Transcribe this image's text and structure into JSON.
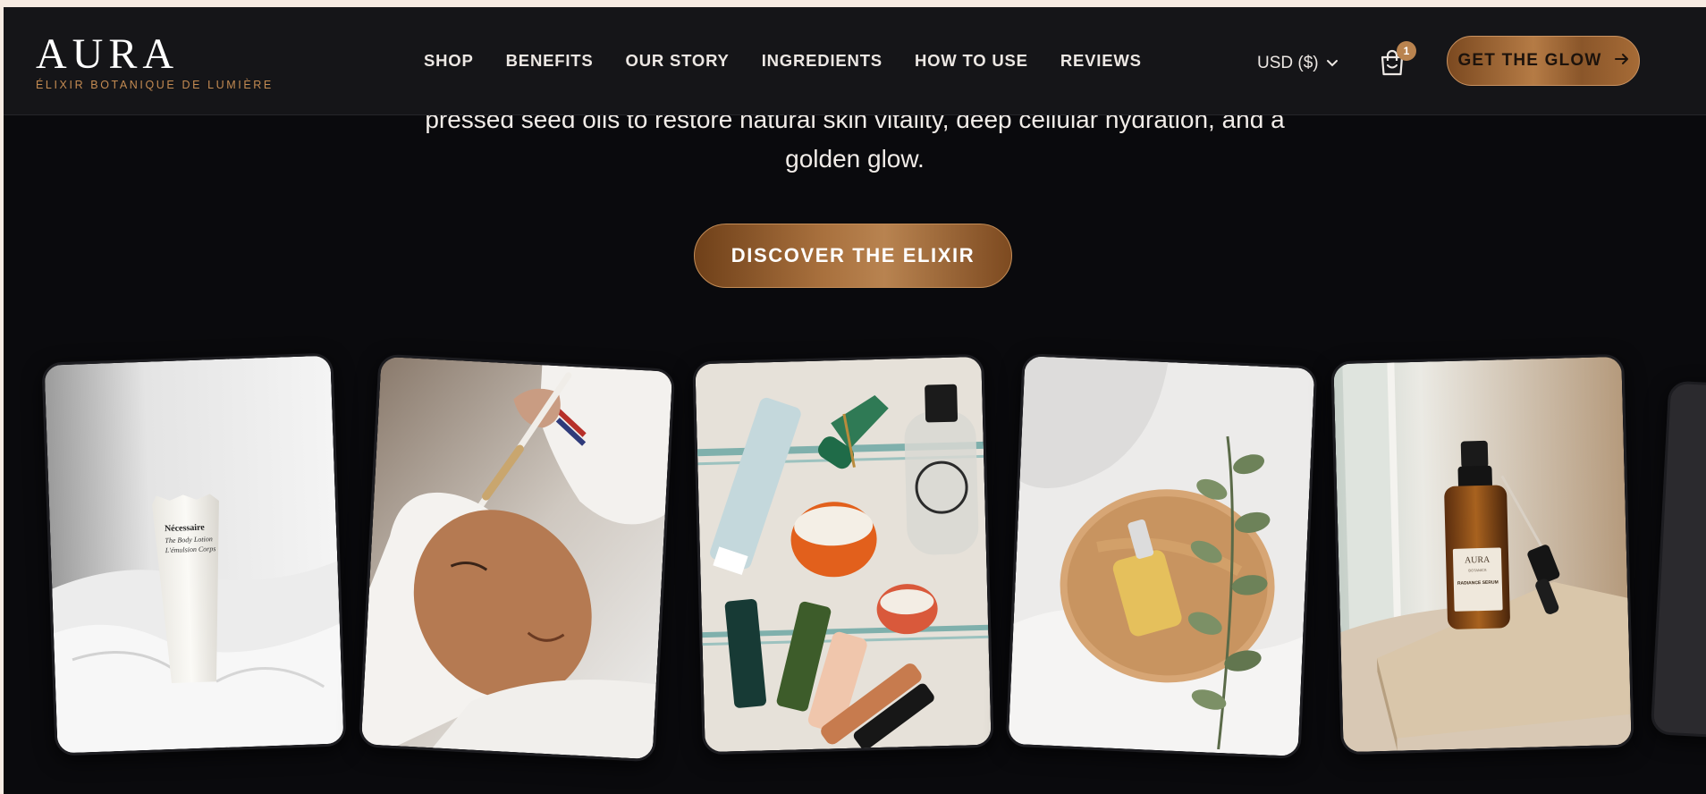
{
  "brand": {
    "name": "AURA",
    "tagline": "ÉLIXIR BOTANIQUE DE LUMIÈRE"
  },
  "nav": {
    "items": [
      {
        "label": "SHOP"
      },
      {
        "label": "BENEFITS"
      },
      {
        "label": "OUR STORY"
      },
      {
        "label": "INGREDIENTS"
      },
      {
        "label": "HOW TO USE"
      },
      {
        "label": "REVIEWS"
      }
    ]
  },
  "header": {
    "currency": "USD ($)",
    "currency_icon": "chevron-down-icon",
    "cart_icon": "shopping-bag-icon",
    "cart_count": "1",
    "cta_label": "GET THE GLOW",
    "cta_icon": "arrow-right-icon"
  },
  "hero": {
    "text_line_1": "pressed seed oils to restore natural skin vitality, deep cellular hydration, and a",
    "text_line_2": "golden glow.",
    "button_label": "DISCOVER THE ELIXIR"
  },
  "gallery": {
    "cards": [
      {
        "subject": "white body lotion tube on white linens",
        "tube_brand": "Nécessaire",
        "tube_line_1": "The Body Lotion",
        "tube_line_2": "L'émulsion Corps"
      },
      {
        "subject": "woman receiving clay face mask treatment"
      },
      {
        "subject": "skincare products flat lay with jade roller"
      },
      {
        "subject": "serum dropper bottle on wooden board with eucalyptus"
      },
      {
        "subject": "amber serum bottle on travertine stone",
        "bottle_brand": "AURA",
        "bottle_sub": "BOTANICS",
        "bottle_label": "RADIANCE SERUM"
      },
      {
        "subject": "partially visible card"
      }
    ]
  },
  "colors": {
    "background": "#0a0a0d",
    "header": "#151518",
    "accent_bronze": "#b57b45",
    "accent_gold_text": "#c48b52"
  }
}
